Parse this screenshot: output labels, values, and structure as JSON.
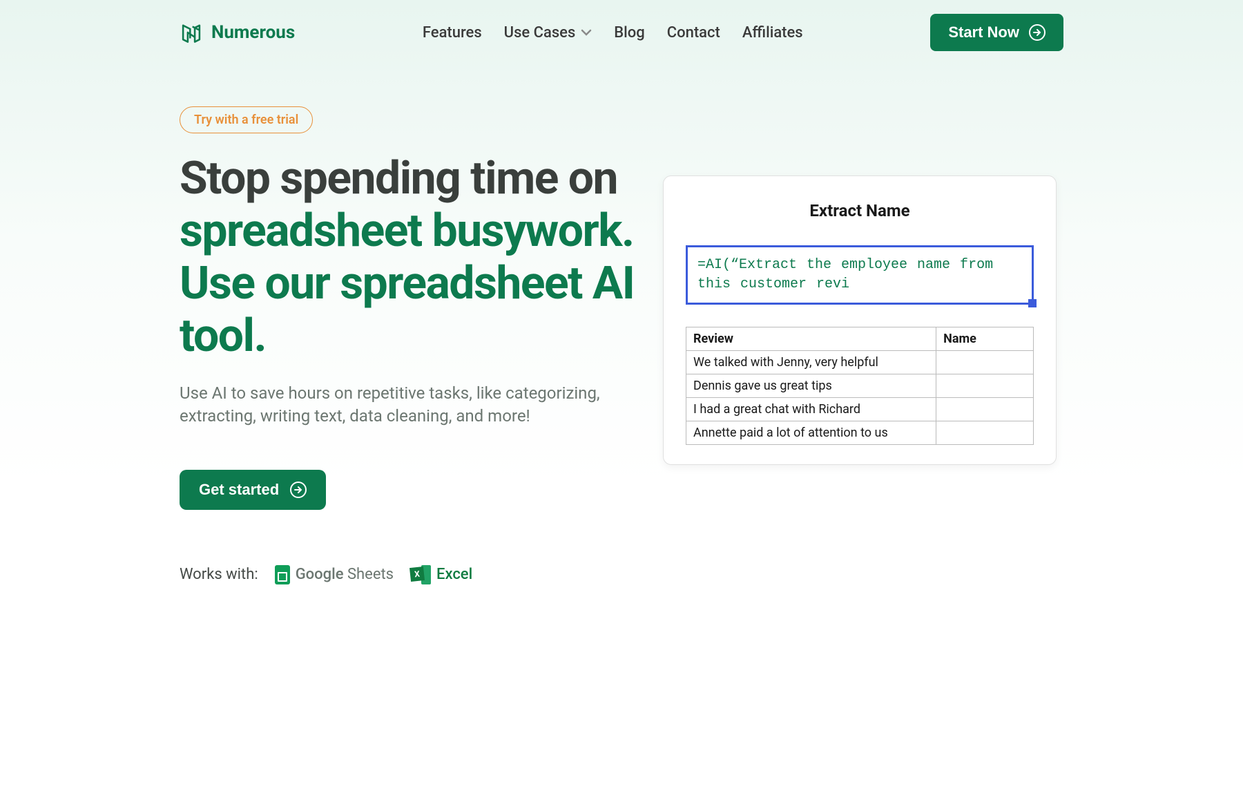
{
  "brand": {
    "name": "Numerous"
  },
  "nav": {
    "features": "Features",
    "use_cases": "Use Cases",
    "blog": "Blog",
    "contact": "Contact",
    "affiliates": "Affiliates"
  },
  "header_cta": "Start Now",
  "hero": {
    "trial_badge": "Try with a free trial",
    "headline_part1": "Stop spending time on ",
    "headline_green": "spreadsheet busywork. Use our spreadsheet AI tool.",
    "subtext": "Use AI to save hours on repetitive tasks, like categorizing, extracting, writing text, data cleaning, and more!",
    "cta": "Get started"
  },
  "works_with": {
    "label": "Works with:",
    "google_sheets_strong": "Google",
    "google_sheets_light": " Sheets",
    "excel": "Excel"
  },
  "demo": {
    "title": "Extract Name",
    "formula": "=AI(“Extract the employee name from this customer revi",
    "columns": {
      "review": "Review",
      "name": "Name"
    },
    "rows": [
      {
        "review": "We talked with Jenny, very helpful",
        "name": ""
      },
      {
        "review": "Dennis gave us great tips",
        "name": ""
      },
      {
        "review": "I had a great chat with Richard",
        "name": ""
      },
      {
        "review": "Annette paid a lot of attention to us",
        "name": ""
      }
    ]
  }
}
